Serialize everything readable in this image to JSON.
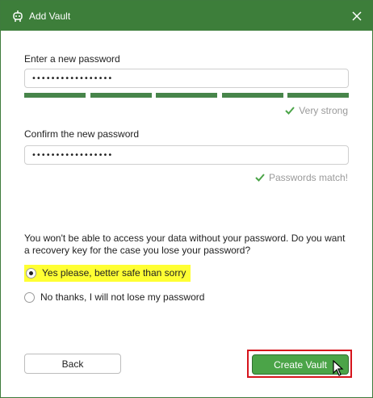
{
  "window": {
    "title": "Add Vault",
    "accent_color": "#3d7e3a",
    "app_icon": "cryptomator-bot-icon",
    "close_icon": "close-icon"
  },
  "password": {
    "label": "Enter a new password",
    "value": "•••••••••••••••••",
    "strength_segments_filled": 5,
    "strength_segments_total": 5,
    "strength_text": "Very strong"
  },
  "confirm": {
    "label": "Confirm the new password",
    "value": "•••••••••••••••••",
    "match_text": "Passwords match!"
  },
  "recovery": {
    "info": "You won't be able to access your data without your password. Do you want a recovery key for the case you lose your password?",
    "options": [
      {
        "label": "Yes please, better safe than sorry",
        "selected": true,
        "highlighted": true
      },
      {
        "label": "No thanks, I will not lose my password",
        "selected": false,
        "highlighted": false
      }
    ]
  },
  "buttons": {
    "back": "Back",
    "create": "Create Vault"
  }
}
